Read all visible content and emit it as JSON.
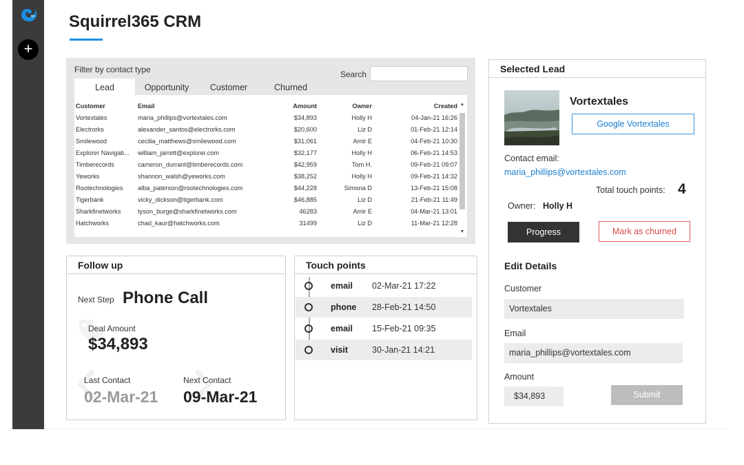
{
  "app": {
    "title": "Squirrel365 CRM"
  },
  "sidebar": {
    "add_label": "+"
  },
  "filter": {
    "label": "Filter by contact type",
    "search_label": "Search",
    "search_value": "",
    "tabs": [
      "Lead",
      "Opportunity",
      "Customer",
      "Churned"
    ],
    "active_tab": "Lead"
  },
  "table": {
    "headers": [
      "Customer",
      "Email",
      "Amount",
      "Owner",
      "Created"
    ],
    "rows": [
      [
        "Vortextales",
        "maria_phillips@vortextales.com",
        "$34,893",
        "Holly H",
        "04-Jan-21 16:26"
      ],
      [
        "Electrorks",
        "alexander_santos@electrorks.com",
        "$20,600",
        "Liz D",
        "01-Feb-21 12:14"
      ],
      [
        "Smilewood",
        "cecilia_matthews@smilewood.com",
        "$31,061",
        "Amir E",
        "04-Feb-21 10:30"
      ],
      [
        "Explorer Navigati...",
        "william_jarrett@explorer.com",
        "$32,177",
        "Holly H",
        "06-Feb-21 14:53"
      ],
      [
        "Timberecords",
        "cameron_durrant@timberecords.com",
        "$42,959",
        "Tom H.",
        "09-Feb-21 09:07"
      ],
      [
        "Yeworks",
        "shannon_walsh@yeworks.com",
        "$38,252",
        "Holly H",
        "09-Feb-21 14:32"
      ],
      [
        "Rootechnologies",
        "alba_paterson@rootechnologies.com",
        "$44,228",
        "Simona D",
        "13-Feb-21 15:08"
      ],
      [
        "Tigerbank",
        "vicky_dickson@tigerbank.com",
        "$46,885",
        "Liz D",
        "21-Feb-21 11:49"
      ],
      [
        "Sharkfinetworks",
        "tyson_burge@sharkfinetworks.com",
        "46283",
        "Amir E",
        "04-Mar-21 13:01"
      ],
      [
        "Hatchworks",
        "chad_kaur@hatchworks.com",
        "31499",
        "Liz D",
        "11-Mar-21 12:28"
      ]
    ]
  },
  "followup": {
    "title": "Follow up",
    "next_step_label": "Next Step",
    "next_step_value": "Phone Call",
    "deal_amount_label": "Deal Amount",
    "deal_amount_value": "$34,893",
    "last_contact_label": "Last Contact",
    "last_contact_value": "02-Mar-21",
    "next_contact_label": "Next Contact",
    "next_contact_value": "09-Mar-21"
  },
  "touchpoints": {
    "title": "Touch points",
    "items": [
      {
        "type": "email",
        "time": "02-Mar-21 17:22"
      },
      {
        "type": "phone",
        "time": "28-Feb-21 14:50"
      },
      {
        "type": "email",
        "time": "15-Feb-21 09:35"
      },
      {
        "type": "visit",
        "time": "30-Jan-21 14:21"
      }
    ]
  },
  "selected": {
    "title": "Selected Lead",
    "name": "Vortextales",
    "google_button": "Google Vortextales",
    "contact_email_label": "Contact email:",
    "contact_email": "maria_phillips@vortextales.com",
    "touch_points_label": "Total touch points:",
    "touch_points_value": "4",
    "owner_label": "Owner:",
    "owner_value": "Holly H",
    "progress_button": "Progress",
    "churn_button": "Mark as churned",
    "edit_title": "Edit Details",
    "customer_label": "Customer",
    "customer_value": "Vortextales",
    "email_label": "Email",
    "email_value": "maria_phillips@vortextales.com",
    "amount_label": "Amount",
    "amount_value": "$34,893",
    "submit_button": "Submit"
  },
  "colors": {
    "accent": "#1a8fe3",
    "sidebar": "#3b3b3b",
    "churn": "#d94848"
  }
}
